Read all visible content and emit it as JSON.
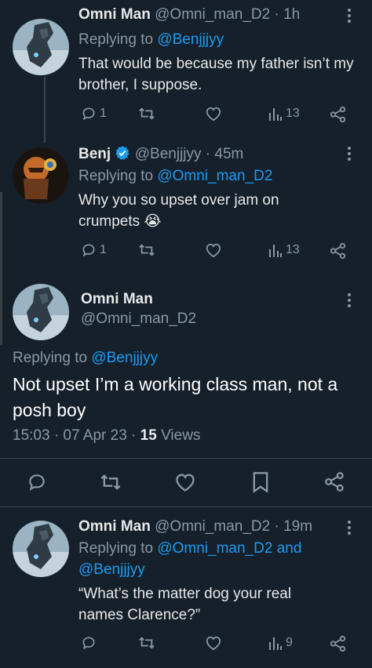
{
  "colors": {
    "background": "#15202b",
    "primary_text": "#e7e9ea",
    "secondary_text": "#8b98a5",
    "accent": "#1d9bf0",
    "divider": "#38444d"
  },
  "tweets": [
    {
      "name": "Omni Man",
      "handle": "@Omni_man_D2",
      "time": "1h",
      "replying_prefix": "Replying to",
      "replying_to": "@Benjjjyy",
      "text": "That would be because my father isn’t my brother, I suppose.",
      "reply_count": "1",
      "views": "13"
    },
    {
      "name": "Benj",
      "handle": "@Benjjjyy",
      "time": "45m",
      "replying_prefix": "Replying to",
      "replying_to": "@Omni_man_D2",
      "text": "Why you so upset over jam on crumpets 😭",
      "reply_count": "1",
      "views": "13"
    }
  ],
  "main_tweet": {
    "name": "Omni Man",
    "handle": "@Omni_man_D2",
    "replying_prefix": "Replying to",
    "replying_to": "@Benjjjyy",
    "text": "Not upset I’m a working class man, not a posh boy",
    "timestamp": "15:03 · 07 Apr 23 ·",
    "views_count": "15",
    "views_label": "Views"
  },
  "last_reply": {
    "name": "Omni Man",
    "handle": "@Omni_man_D2",
    "time": "19m",
    "replying_prefix": "Replying to",
    "replying_to_1": "@Omni_man_D2",
    "replying_and": "and",
    "replying_to_2": "@Benjjjyy",
    "text": "“What’s the matter dog your real names Clarence?”",
    "views": "9"
  },
  "separator_dot": "·",
  "icons": [
    "reply-icon",
    "retweet-icon",
    "like-icon",
    "views-icon",
    "share-icon",
    "bookmark-icon",
    "more-icon",
    "verified-icon"
  ]
}
